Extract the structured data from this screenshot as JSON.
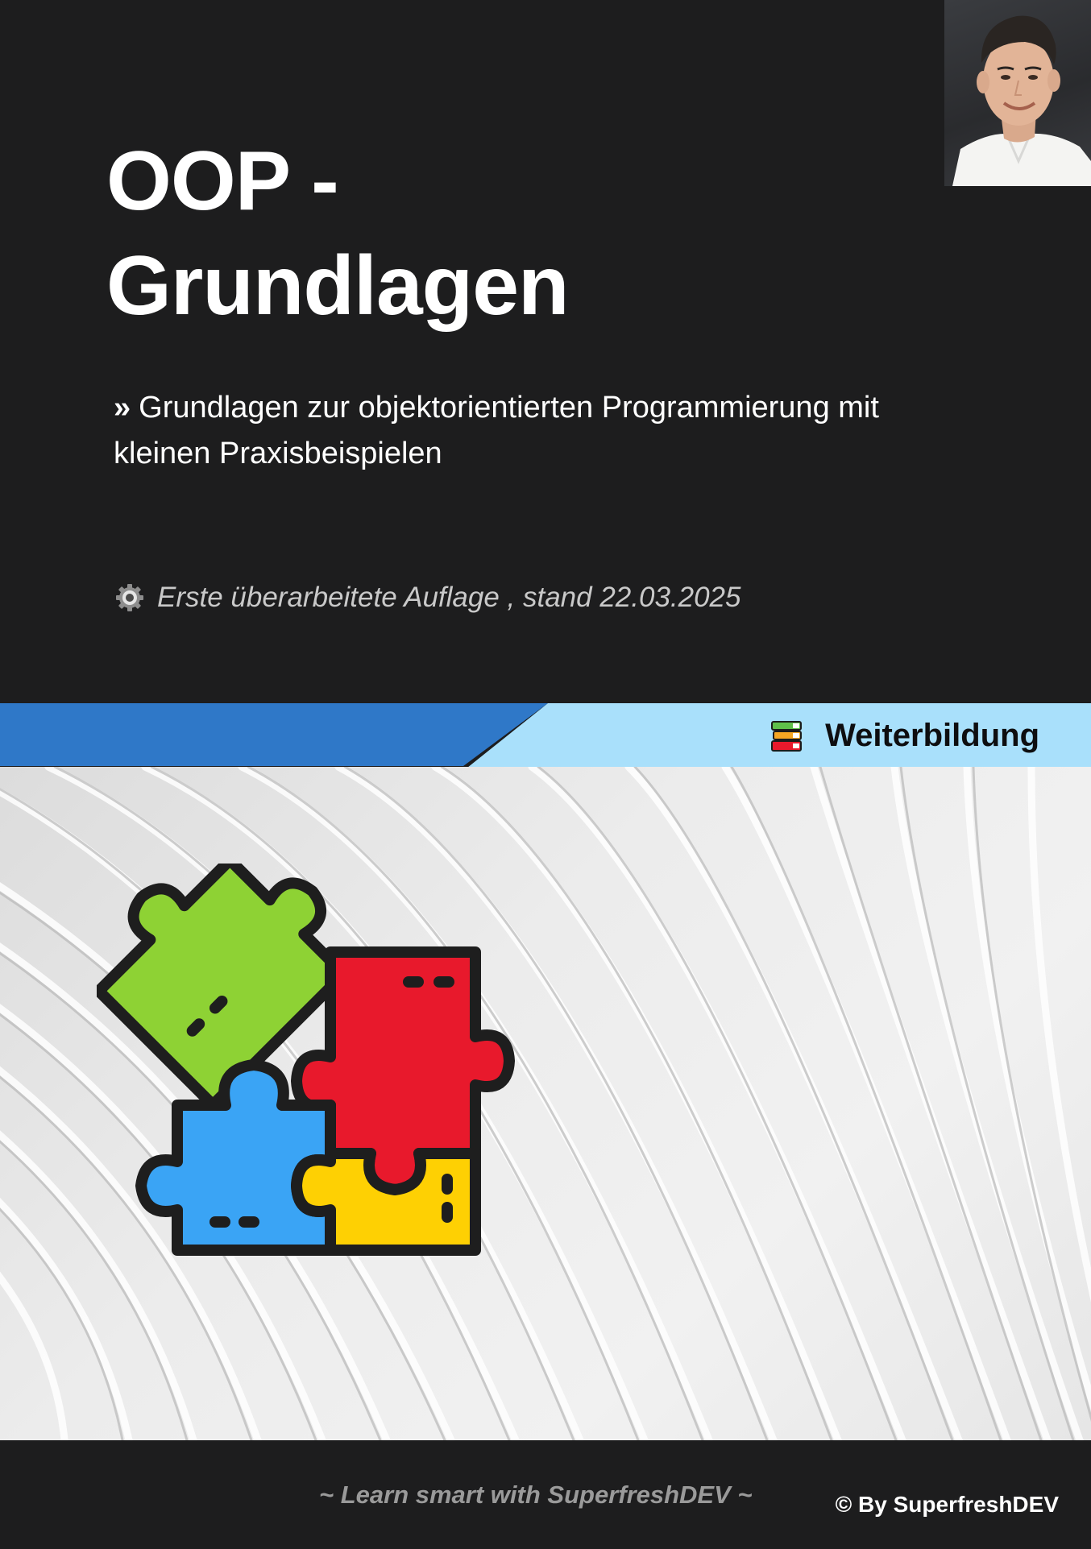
{
  "cover": {
    "title_line1": "OOP -",
    "title_line2": "Grundlagen",
    "subtitle_marker": "»",
    "subtitle": "Grundlagen zur objektorientierten Programmierung mit kleinen Praxisbeispielen",
    "edition_icon": "gear-icon",
    "edition": "Erste überarbeitete Auflage , stand 22.03.2025"
  },
  "banner": {
    "icon": "books-icon",
    "label": "Weiterbildung",
    "colors": {
      "left": "#2f78c8",
      "right": "#a9e0fb"
    }
  },
  "hero": {
    "illustration": "puzzle-pieces-icon",
    "piece_colors": [
      "#8ed234",
      "#e8192c",
      "#3aa4f5",
      "#fed003"
    ]
  },
  "footer": {
    "slogan": "~ Learn smart with SuperfreshDEV ~",
    "copyright": "© By SuperfreshDEV"
  },
  "colors": {
    "background": "#1d1d1e",
    "text": "#ffffff",
    "muted": "#9a9a9a"
  }
}
